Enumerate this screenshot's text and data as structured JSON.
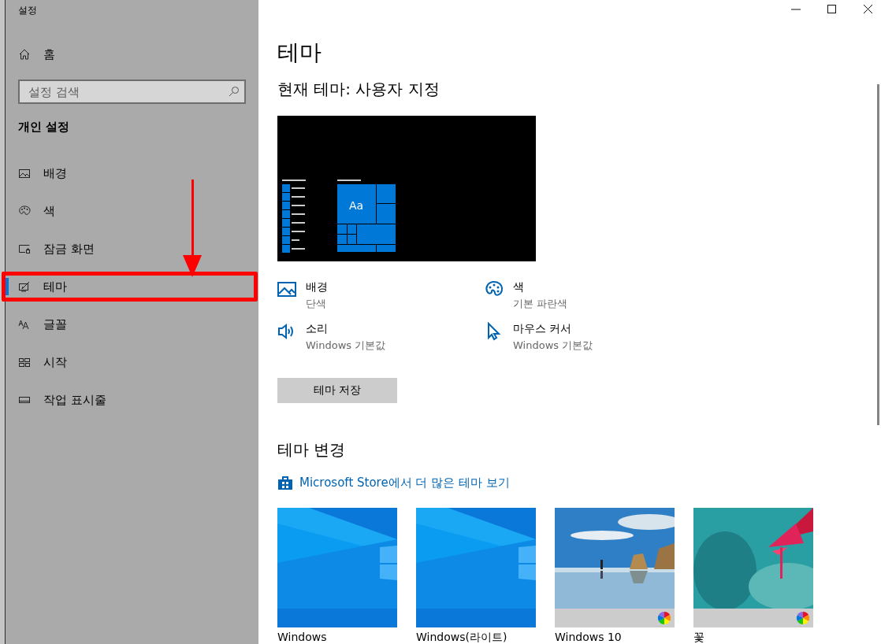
{
  "window": {
    "title": "설정"
  },
  "sidebar": {
    "home": "홈",
    "search": {
      "placeholder": "설정 검색"
    },
    "section": "개인 설정",
    "items": [
      {
        "label": "배경",
        "selected": false,
        "highlighted": false
      },
      {
        "label": "색",
        "selected": false,
        "highlighted": false
      },
      {
        "label": "잠금 화면",
        "selected": false,
        "highlighted": false
      },
      {
        "label": "테마",
        "selected": true,
        "highlighted": true
      },
      {
        "label": "글꼴",
        "selected": false,
        "highlighted": false
      },
      {
        "label": "시작",
        "selected": false,
        "highlighted": false
      },
      {
        "label": "작업 표시줄",
        "selected": false,
        "highlighted": false
      }
    ]
  },
  "page": {
    "title": "테마",
    "current_theme": "현재 테마: 사용자 지정",
    "preview": {
      "tile_text": "Aa"
    },
    "properties": [
      {
        "title": "배경",
        "value": "단색"
      },
      {
        "title": "색",
        "value": "기본 파란색"
      },
      {
        "title": "소리",
        "value": "Windows 기본값"
      },
      {
        "title": "마우스 커서",
        "value": "Windows 기본값"
      }
    ],
    "save_button": "테마 저장",
    "change_heading": "테마 변경",
    "store_link": "Microsoft Store에서 더 많은 테마 보기",
    "themes": [
      {
        "name": "Windows",
        "kind": "windows",
        "auto_color": false
      },
      {
        "name": "Windows(라이트)",
        "kind": "windows",
        "auto_color": false
      },
      {
        "name": "Windows 10",
        "kind": "beach",
        "auto_color": true
      },
      {
        "name": "꽃",
        "kind": "flower",
        "auto_color": true
      }
    ]
  }
}
